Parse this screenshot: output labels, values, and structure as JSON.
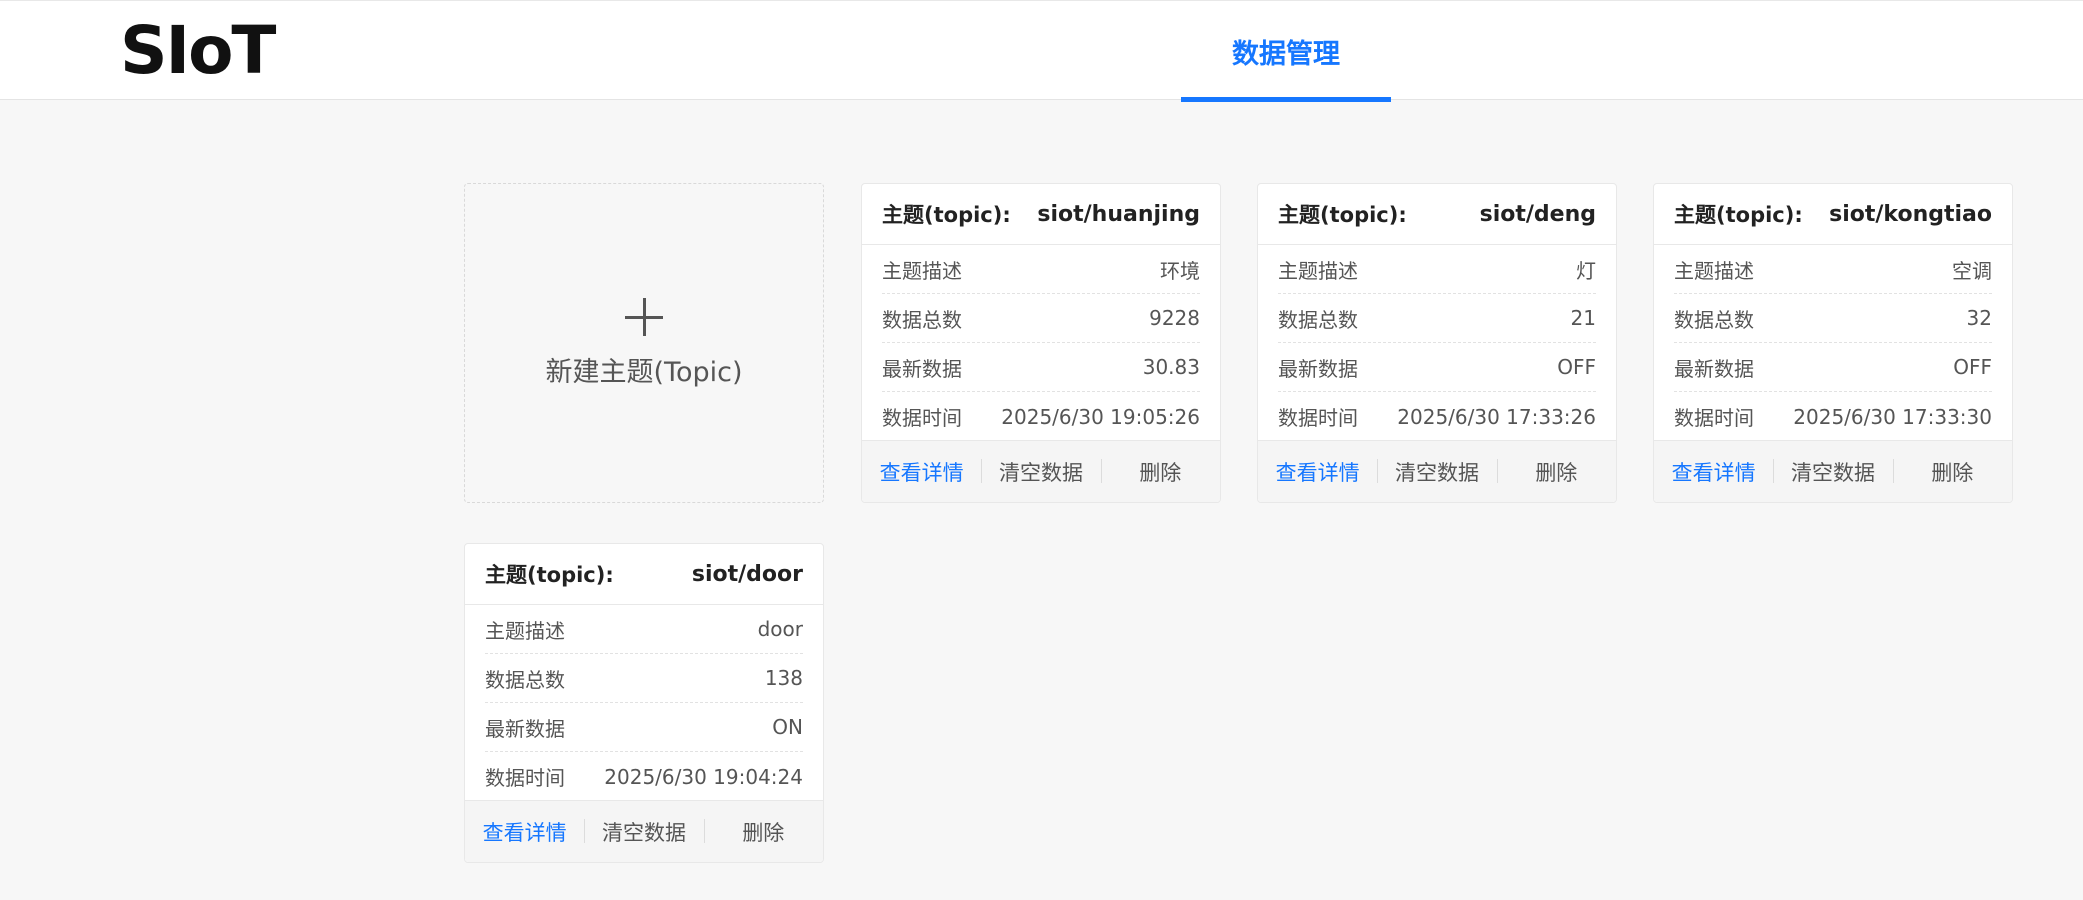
{
  "header": {
    "logo": "SIoT",
    "nav_tab": "数据管理"
  },
  "new_topic": {
    "label": "新建主题(Topic)"
  },
  "field_labels": {
    "topic": "主题(topic):",
    "description": "主题描述",
    "total": "数据总数",
    "latest": "最新数据",
    "time": "数据时间"
  },
  "actions": {
    "detail": "查看详情",
    "clear": "清空数据",
    "delete": "删除"
  },
  "topics": [
    {
      "name": "siot/huanjing",
      "description": "环境",
      "total": "9228",
      "latest": "30.83",
      "time": "2025/6/30 19:05:26"
    },
    {
      "name": "siot/deng",
      "description": "灯",
      "total": "21",
      "latest": "OFF",
      "time": "2025/6/30 17:33:26"
    },
    {
      "name": "siot/kongtiao",
      "description": "空调",
      "total": "32",
      "latest": "OFF",
      "time": "2025/6/30 17:33:30"
    },
    {
      "name": "siot/door",
      "description": "door",
      "total": "138",
      "latest": "ON",
      "time": "2025/6/30 19:04:24"
    }
  ],
  "colors": {
    "accent": "#1677ff",
    "background": "#f7f7f7"
  }
}
